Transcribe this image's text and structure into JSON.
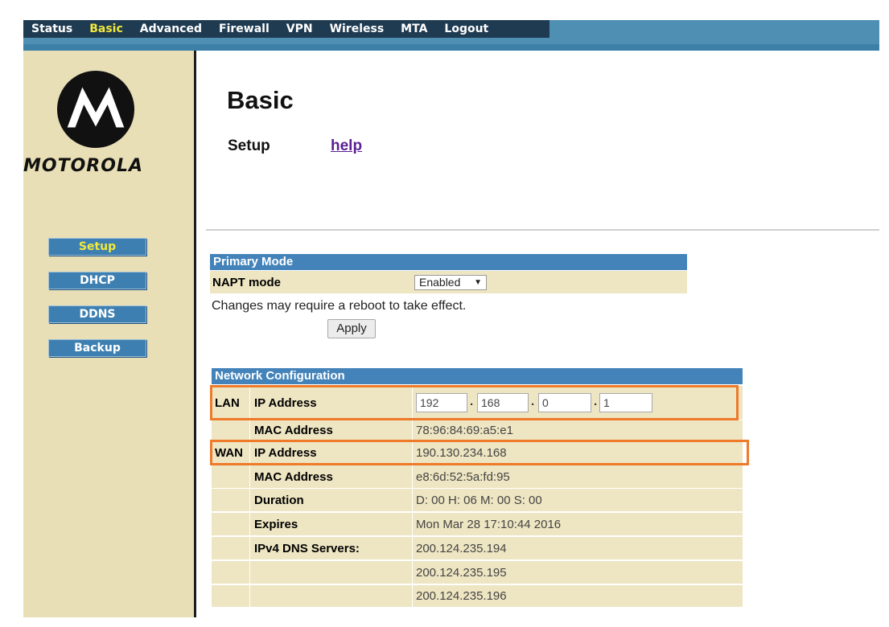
{
  "nav": {
    "tabs": [
      {
        "label": "Status"
      },
      {
        "label": "Basic"
      },
      {
        "label": "Advanced"
      },
      {
        "label": "Firewall"
      },
      {
        "label": "VPN"
      },
      {
        "label": "Wireless"
      },
      {
        "label": "MTA"
      },
      {
        "label": "Logout"
      }
    ],
    "active_tab": "Basic"
  },
  "brand": {
    "name": "MOTOROLA",
    "logo_icon": "motorola-batwing-logo"
  },
  "sidebar": {
    "items": [
      {
        "label": "Setup",
        "active": true
      },
      {
        "label": "DHCP"
      },
      {
        "label": "DDNS"
      },
      {
        "label": "Backup"
      }
    ]
  },
  "page": {
    "title": "Basic",
    "subtitle": "Setup",
    "help_link": "help"
  },
  "primary_mode": {
    "header": "Primary Mode",
    "napt_label": "NAPT mode",
    "napt_value": "Enabled",
    "reboot_note": "Changes may require a reboot to take effect.",
    "apply_label": "Apply"
  },
  "network": {
    "header": "Network Configuration",
    "lan_label": "LAN",
    "wan_label": "WAN",
    "lan_ip_label": "IP Address",
    "lan_ip": [
      "192",
      "168",
      "0",
      "1"
    ],
    "lan_mac_label": "MAC Address",
    "lan_mac": "78:96:84:69:a5:e1",
    "wan_ip_label": "IP Address",
    "wan_ip": "190.130.234.168",
    "wan_mac_label": "MAC Address",
    "wan_mac": "e8:6d:52:5a:fd:95",
    "duration_label": "Duration",
    "duration": "D: 00 H: 06 M: 00 S: 00",
    "expires_label": "Expires",
    "expires": "Mon Mar 28 17:10:44 2016",
    "dns_label": "IPv4 DNS Servers:",
    "dns": [
      "200.124.235.194",
      "200.124.235.195",
      "200.124.235.196"
    ]
  },
  "colors": {
    "nav_dark": "#1f3b52",
    "nav_blue": "#4f8fb4",
    "active_yellow": "#f2e93c",
    "sidebar_bg": "#e9dfb6",
    "table_header": "#4383ba",
    "table_row": "#eee5c2",
    "highlight": "#ee7a2a",
    "link": "#5a1f93"
  }
}
